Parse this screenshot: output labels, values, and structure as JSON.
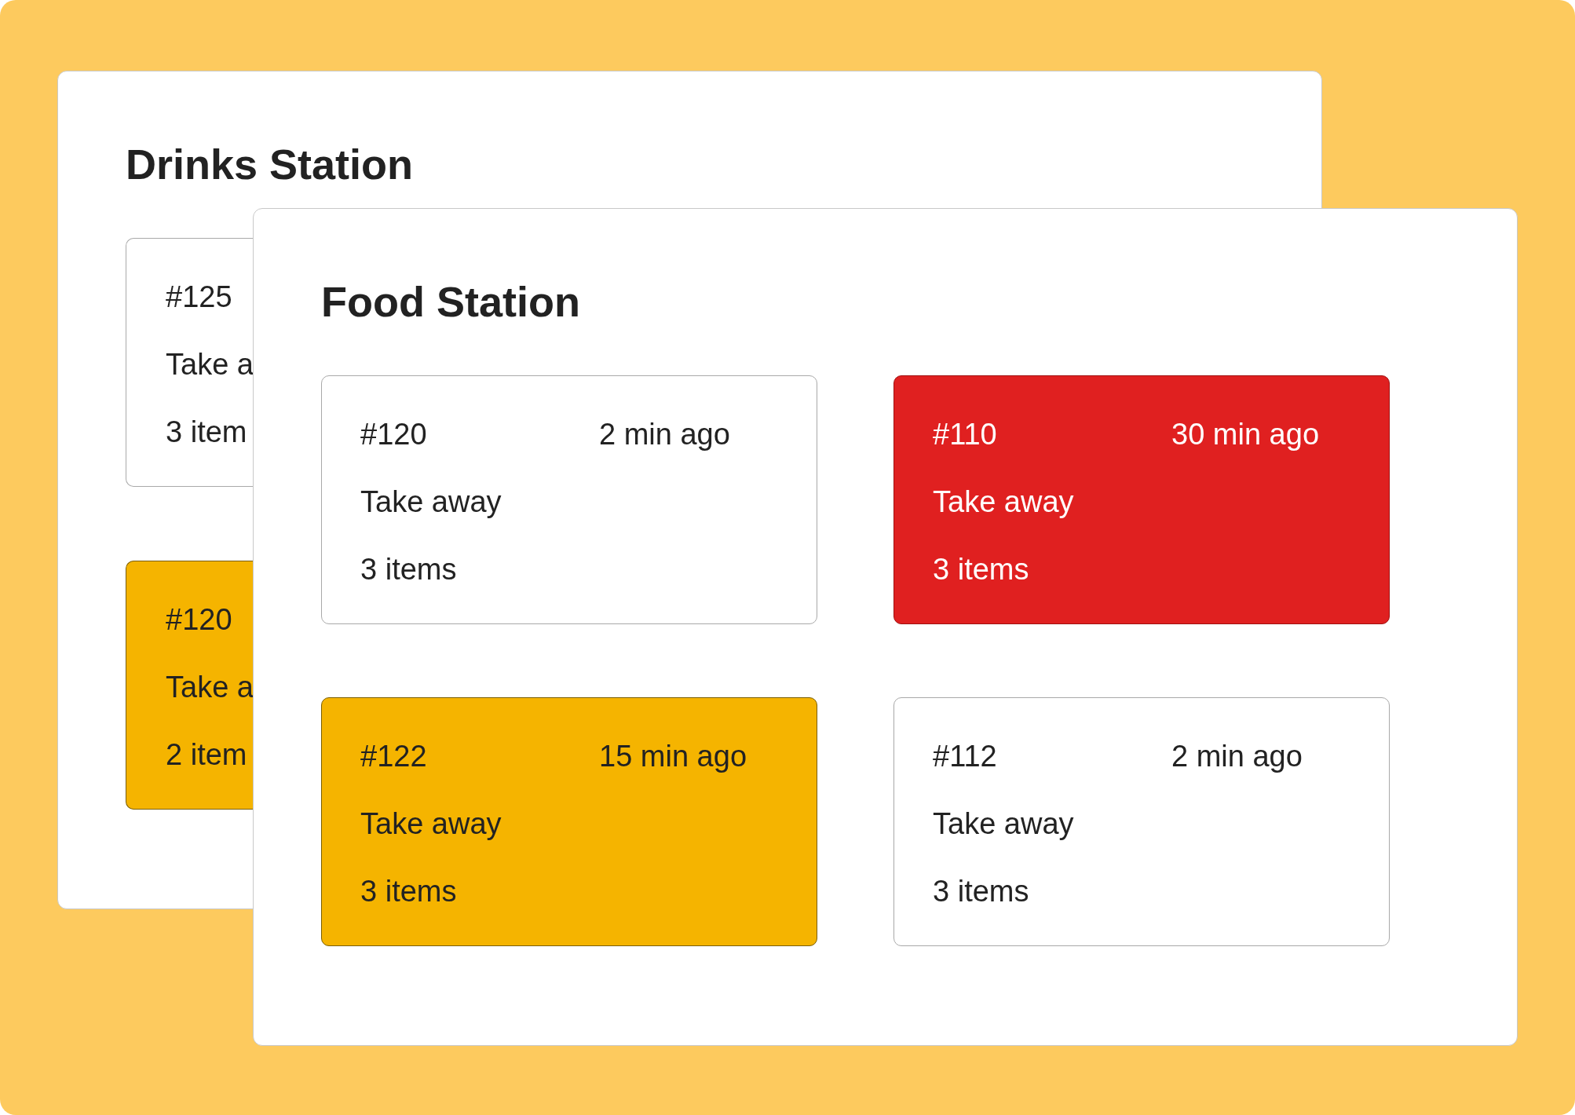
{
  "stations": [
    {
      "title": "Drinks Station",
      "orders": [
        {
          "number": "#125",
          "type": "Take a",
          "items": "3 item",
          "color": "#ffffff"
        },
        {
          "number": "#120",
          "type": "Take a",
          "items": "2 item",
          "color": "#f5b400"
        }
      ]
    },
    {
      "title": "Food Station",
      "orders": [
        {
          "number": "#120",
          "time": "2 min ago",
          "type": "Take away",
          "items": "3 items",
          "color": "#ffffff"
        },
        {
          "number": "#110",
          "time": "30 min ago",
          "type": "Take away",
          "items": "3 items",
          "color": "#e02020"
        },
        {
          "number": "#122",
          "time": "15 min ago",
          "type": "Take away",
          "items": "3 items",
          "color": "#f5b400"
        },
        {
          "number": "#112",
          "time": "2 min ago",
          "type": "Take away",
          "items": "3 items",
          "color": "#ffffff"
        }
      ]
    }
  ]
}
